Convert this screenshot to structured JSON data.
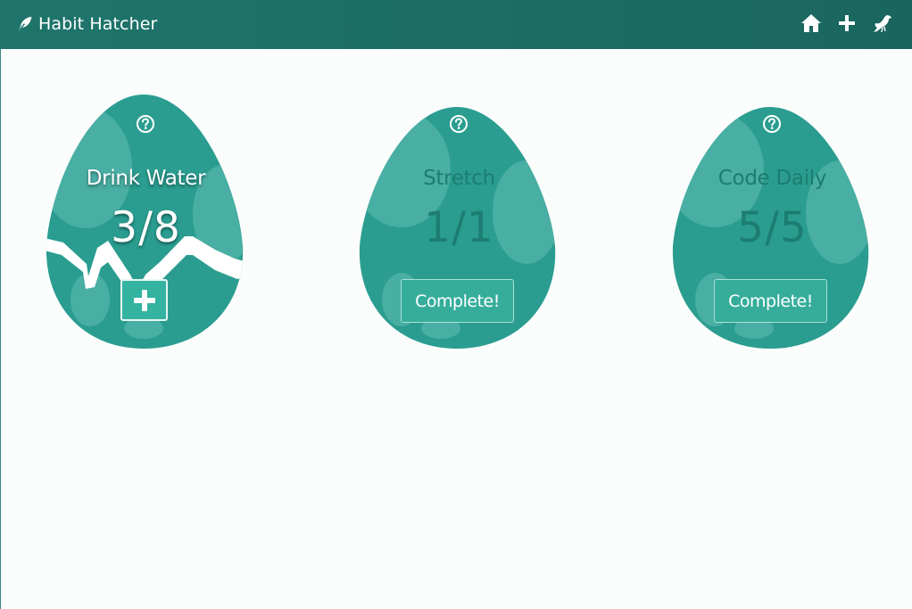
{
  "app": {
    "brand": "Habit Hatcher",
    "brand_icon": "feather-icon"
  },
  "nav": {
    "items": [
      {
        "name": "home-icon"
      },
      {
        "name": "plus-icon"
      },
      {
        "name": "crow-icon"
      }
    ]
  },
  "colors": {
    "navbar": "#1f756b",
    "egg": "#2a9d90",
    "spot": "#52b3a8",
    "button": "#36ad9b",
    "background": "#fbfdfd"
  },
  "habits": [
    {
      "title": "Drink Water",
      "progress": "3/8",
      "action_icon": "plus-icon",
      "state": "in-progress",
      "help_icon": "question-circle-icon"
    },
    {
      "title": "Stretch",
      "progress": "1/1",
      "action_label": "Complete!",
      "state": "completed",
      "help_icon": "question-circle-icon"
    },
    {
      "title": "Code Daily",
      "progress": "5/5",
      "action_label": "Complete!",
      "state": "completed",
      "help_icon": "question-circle-icon"
    }
  ]
}
